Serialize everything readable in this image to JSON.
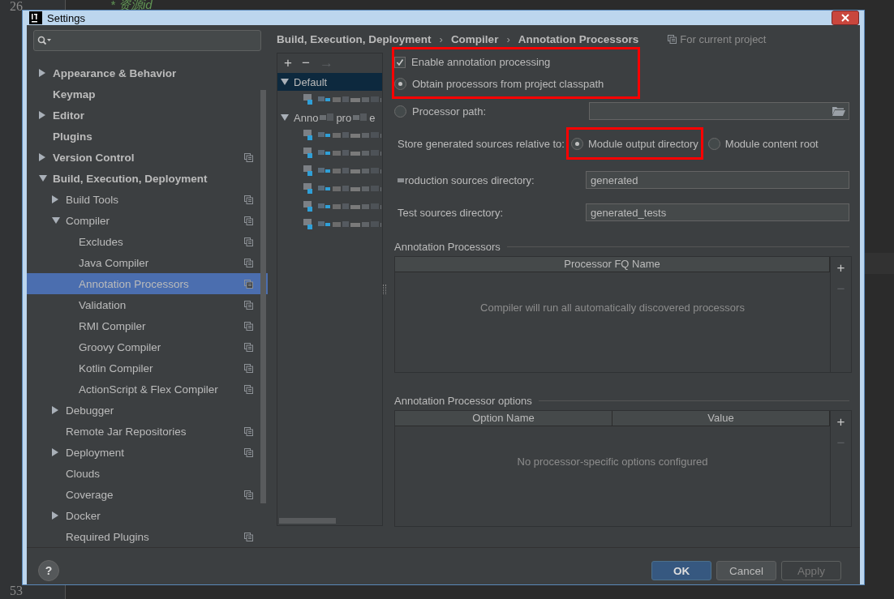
{
  "editor": {
    "line_numbers": [
      "26",
      "53"
    ],
    "code_line": "* 资源id"
  },
  "window": {
    "title": "Settings"
  },
  "sidebar": {
    "items": [
      {
        "label": "Appearance & Behavior",
        "expanded": false,
        "selected": false,
        "project_scope": false
      },
      {
        "label": "Keymap",
        "selected": false,
        "project_scope": false
      },
      {
        "label": "Editor",
        "expanded": false,
        "selected": false,
        "project_scope": false
      },
      {
        "label": "Plugins",
        "selected": false,
        "project_scope": false
      },
      {
        "label": "Version Control",
        "expanded": false,
        "selected": false,
        "project_scope": true
      },
      {
        "label": "Build, Execution, Deployment",
        "expanded": true,
        "selected": false,
        "project_scope": false,
        "children": [
          {
            "label": "Build Tools",
            "expanded": false,
            "selected": false,
            "project_scope": true
          },
          {
            "label": "Compiler",
            "expanded": true,
            "selected": false,
            "project_scope": true,
            "children": [
              {
                "label": "Excludes",
                "selected": false,
                "project_scope": true
              },
              {
                "label": "Java Compiler",
                "selected": false,
                "project_scope": true
              },
              {
                "label": "Annotation Processors",
                "selected": true,
                "project_scope": true
              },
              {
                "label": "Validation",
                "selected": false,
                "project_scope": true
              },
              {
                "label": "RMI Compiler",
                "selected": false,
                "project_scope": true
              },
              {
                "label": "Groovy Compiler",
                "selected": false,
                "project_scope": true
              },
              {
                "label": "Kotlin Compiler",
                "selected": false,
                "project_scope": true
              },
              {
                "label": "ActionScript & Flex Compiler",
                "selected": false,
                "project_scope": true
              }
            ]
          },
          {
            "label": "Debugger",
            "expanded": false,
            "selected": false,
            "project_scope": false
          },
          {
            "label": "Remote Jar Repositories",
            "selected": false,
            "project_scope": true
          },
          {
            "label": "Deployment",
            "expanded": false,
            "selected": false,
            "project_scope": true
          },
          {
            "label": "Clouds",
            "selected": false,
            "project_scope": false
          },
          {
            "label": "Coverage",
            "selected": false,
            "project_scope": true
          },
          {
            "label": "Docker",
            "expanded": false,
            "selected": false,
            "project_scope": false
          },
          {
            "label": "Required Plugins",
            "selected": false,
            "project_scope": true
          }
        ]
      }
    ]
  },
  "breadcrumb": {
    "parts": [
      "Build, Execution, Deployment",
      "Compiler",
      "Annotation Processors"
    ],
    "separator": "›"
  },
  "scope_note": "For current project",
  "profiles": {
    "toolbar": [
      {
        "label": "+",
        "disabled": false
      },
      {
        "label": "−",
        "disabled": false
      },
      {
        "label": "→",
        "disabled": true
      }
    ],
    "tree": [
      {
        "label_parts": [
          "Default"
        ],
        "expanded": true,
        "selected": true,
        "children": [
          {
            "kind": "obscured"
          }
        ]
      },
      {
        "label_parts": [
          "Anno",
          "pro",
          "e"
        ],
        "expanded": true,
        "selected": false,
        "children": [
          {
            "kind": "obscured"
          },
          {
            "kind": "obscured"
          },
          {
            "kind": "obscured"
          },
          {
            "kind": "obscured"
          },
          {
            "kind": "obscured"
          },
          {
            "kind": "obscured"
          }
        ]
      }
    ]
  },
  "options": {
    "processing": {
      "highlighted": true,
      "enable": {
        "label": "Enable annotation processing",
        "checked": true
      },
      "from_classpath": {
        "label": "Obtain processors from project classpath",
        "selected": true
      }
    },
    "processor_path": {
      "label": "Processor path:",
      "selected": false
    },
    "store": {
      "label": "Store generated sources relative to:",
      "choices": [
        {
          "label": "Module output directory",
          "selected": true,
          "highlighted": true
        },
        {
          "label": "Module content root",
          "selected": false,
          "highlighted": false
        }
      ]
    },
    "fields": [
      {
        "label": "roduction sources directory:",
        "obscured_start": true,
        "value": "generated"
      },
      {
        "label": "Test sources directory:",
        "obscured_start": false,
        "value": "generated_tests"
      }
    ]
  },
  "processors_table": {
    "title": "Annotation Processors",
    "columns": [
      "Processor FQ Name"
    ],
    "empty_text": "Compiler will run all automatically discovered processors",
    "actions": [
      {
        "label": "+",
        "disabled": false
      },
      {
        "label": "−",
        "disabled": true
      }
    ]
  },
  "options_table": {
    "title": "Annotation Processor options",
    "columns": [
      "Option Name",
      "Value"
    ],
    "empty_text": "No processor-specific options configured",
    "actions": [
      {
        "label": "+",
        "disabled": false
      },
      {
        "label": "−",
        "disabled": true
      }
    ]
  },
  "footer": {
    "help": "?",
    "buttons": [
      {
        "label": "OK",
        "kind": "default",
        "disabled": false
      },
      {
        "label": "Cancel",
        "kind": "normal",
        "disabled": false
      },
      {
        "label": "Apply",
        "kind": "normal",
        "disabled": true
      }
    ]
  }
}
